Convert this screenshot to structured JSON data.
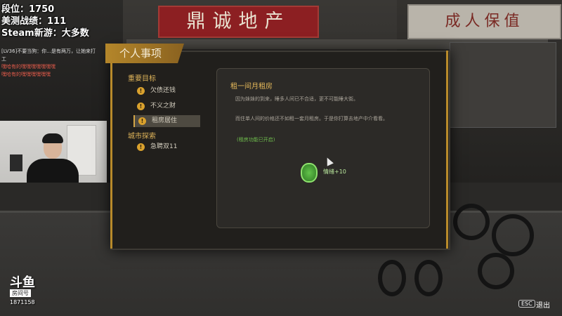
{
  "stream": {
    "line1": "段位：1750",
    "line2": "美测战绩：111",
    "line3": "Steam新游：大多数",
    "chat": [
      "[LV36]不要当狗：你...是有两万，让她来打",
      "工",
      "嘿哈有的嘿嘿嘿嘿嘿嘿嘿",
      "嘿哈有的嘿嘿嘿嘿嘿嘿"
    ],
    "platform_logo": "斗鱼",
    "room_label": "房间号",
    "room_id": "1871158"
  },
  "scene": {
    "shop_sign": "鼎诚地产",
    "shop_sign_right": "成人保值"
  },
  "panel": {
    "title": "个人事项",
    "sections": [
      {
        "heading": "重要目标",
        "tasks": [
          {
            "label": "欠债还钱",
            "active": false
          },
          {
            "label": "不义之财",
            "active": false
          },
          {
            "label": "租房居住",
            "active": true
          }
        ]
      },
      {
        "heading": "城市探索",
        "tasks": [
          {
            "label": "急聘双11",
            "active": false
          }
        ]
      }
    ],
    "detail": {
      "title": "租一间月租房",
      "paragraph1": "因为妹妹的到来，睡多人间已不合适，更不可能睡大街。",
      "paragraph2": "而住单人间的价格还不如租一套月租房。于是你打算去地产中介看看。",
      "unlock_note": "(租房功能已开启)",
      "reward": "情绪+10"
    }
  },
  "controls": {
    "esc_key": "ESC",
    "exit_label": "退出"
  },
  "colors": {
    "accent_gold": "#d4a647",
    "reward_green": "#6fbf4d"
  }
}
